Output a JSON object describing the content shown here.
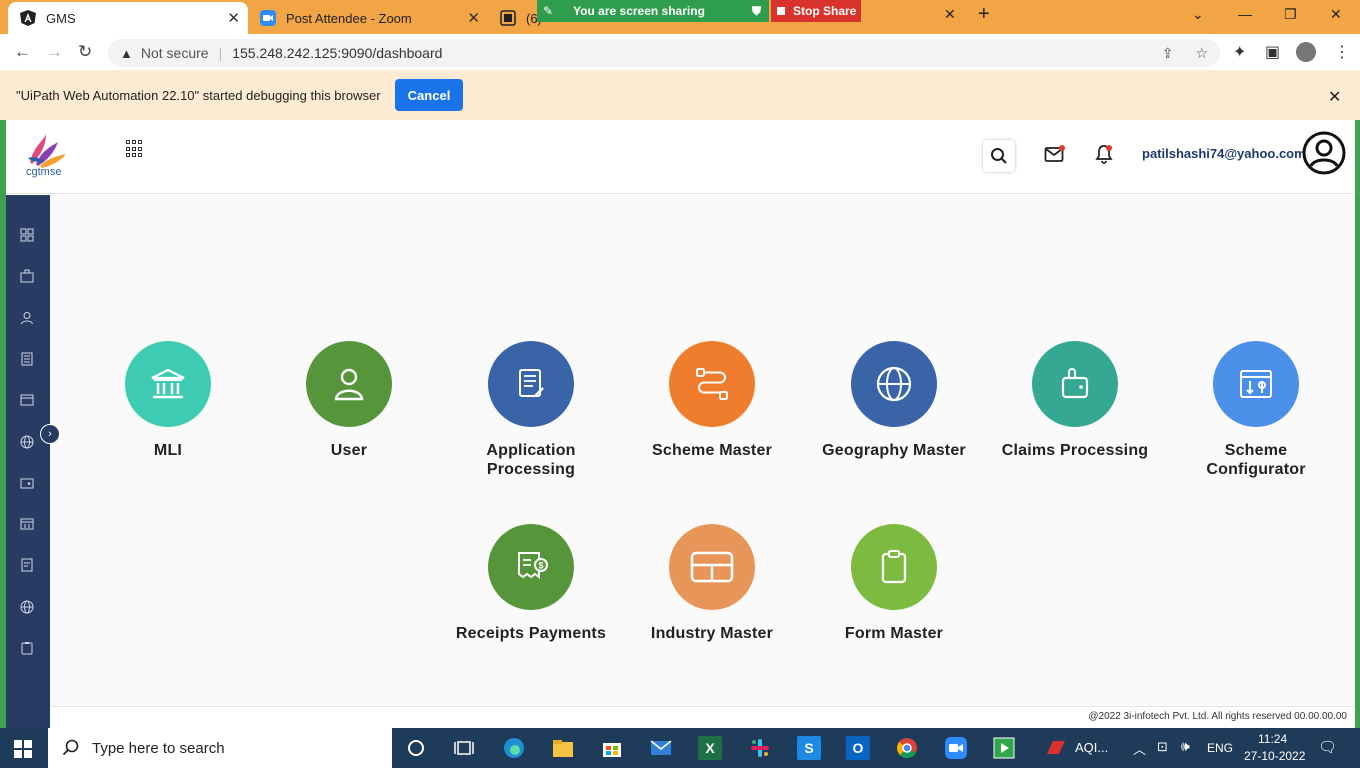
{
  "browser": {
    "tabs": [
      {
        "title": "GMS",
        "active": true,
        "icon": "angular-icon"
      },
      {
        "title": "Post Attendee - Zoom",
        "active": false,
        "icon": "zoom-icon"
      },
      {
        "title": "(6)",
        "active": false,
        "icon": "app-icon"
      }
    ],
    "screen_share_text": "You are screen sharing",
    "stop_share_label": "Stop Share",
    "security_label": "Not secure",
    "url": "155.248.242.125:9090/dashboard"
  },
  "infobar": {
    "message": "\"UiPath Web Automation 22.10\" started debugging this browser",
    "cancel_label": "Cancel"
  },
  "app": {
    "logo_text": "cgtmse",
    "user_email": "patilshashi74@yahoo.com",
    "brand_colors": {
      "sidebar": "#283b63",
      "accent": "#1d3a6e"
    }
  },
  "dashboard": {
    "tiles": [
      {
        "label": "MLI",
        "icon": "bank-icon",
        "color": "#3ecbb2"
      },
      {
        "label": "User",
        "icon": "user-icon",
        "color": "#57953a"
      },
      {
        "label": "Application Processing",
        "icon": "document-edit-icon",
        "color": "#3a64a8"
      },
      {
        "label": "Scheme Master",
        "icon": "flow-icon",
        "color": "#f07c2e"
      },
      {
        "label": "Geography Master",
        "icon": "globe-icon",
        "color": "#3a64a8"
      },
      {
        "label": "Claims Processing",
        "icon": "wallet-icon",
        "color": "#35a893"
      },
      {
        "label": "Scheme Configurator",
        "icon": "config-icon",
        "color": "#4a90e8"
      },
      {
        "label": "Receipts Payments",
        "icon": "receipt-icon",
        "color": "#57953a"
      },
      {
        "label": "Industry Master",
        "icon": "card-icon",
        "color": "#e8955a"
      },
      {
        "label": "Form Master",
        "icon": "clipboard-icon",
        "color": "#7cbb3f"
      }
    ]
  },
  "footer": {
    "text": "@2022 3i-infotech Pvt. Ltd. All rights reserved 00.00.00.00"
  },
  "taskbar": {
    "search_placeholder": "Type here to search",
    "pinned_app_label": "AQI...",
    "language": "ENG",
    "time": "11:24",
    "date": "27-10-2022"
  }
}
